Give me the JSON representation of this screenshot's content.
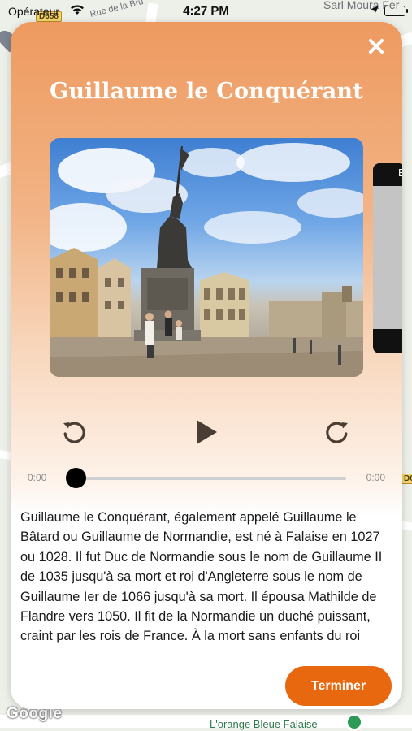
{
  "status_bar": {
    "carrier": "Opérateur",
    "time": "4:27 PM"
  },
  "map": {
    "street_label": "Rue de la Bru",
    "business_label": "Sarl Moura Fer",
    "poi_label": "L'orange Bleue Falaise",
    "road_badge": "D658",
    "road_badge_right": "D6",
    "google_logo": "Google"
  },
  "modal": {
    "title": "Guillaume le Conquérant",
    "image_subject": "Statue équestre de Guillaume le Conquérant à Falaise",
    "side_thumb_text": "EN",
    "player": {
      "current_time": "0:00",
      "duration": "0:00",
      "progress": 0,
      "state": "paused"
    },
    "description": "Guillaume le Conquérant, également appelé Guillaume le Bâtard ou Guillaume de Normandie, est né à Falaise en 1027 ou 1028. Il fut Duc de Normandie sous le nom de Guillaume II de 1035 jusqu'à sa mort et roi d'Angleterre sous le nom de Guillaume Ier de 1066 jusqu'à sa mort. Il épousa Mathilde de Flandre vers 1050. Il fit de la Normandie un duché puissant, craint par les rois de France. À la mort sans enfants du roi",
    "finish_label": "Terminer"
  },
  "colors": {
    "accent": "#e8680f",
    "header_gradient_top": "#ee9a5f"
  },
  "icons": {
    "close": "close-icon",
    "rewind": "rewind-icon",
    "play": "play-icon",
    "forward": "forward-icon",
    "wifi": "wifi-icon",
    "location": "location-arrow-icon",
    "battery": "battery-icon"
  }
}
